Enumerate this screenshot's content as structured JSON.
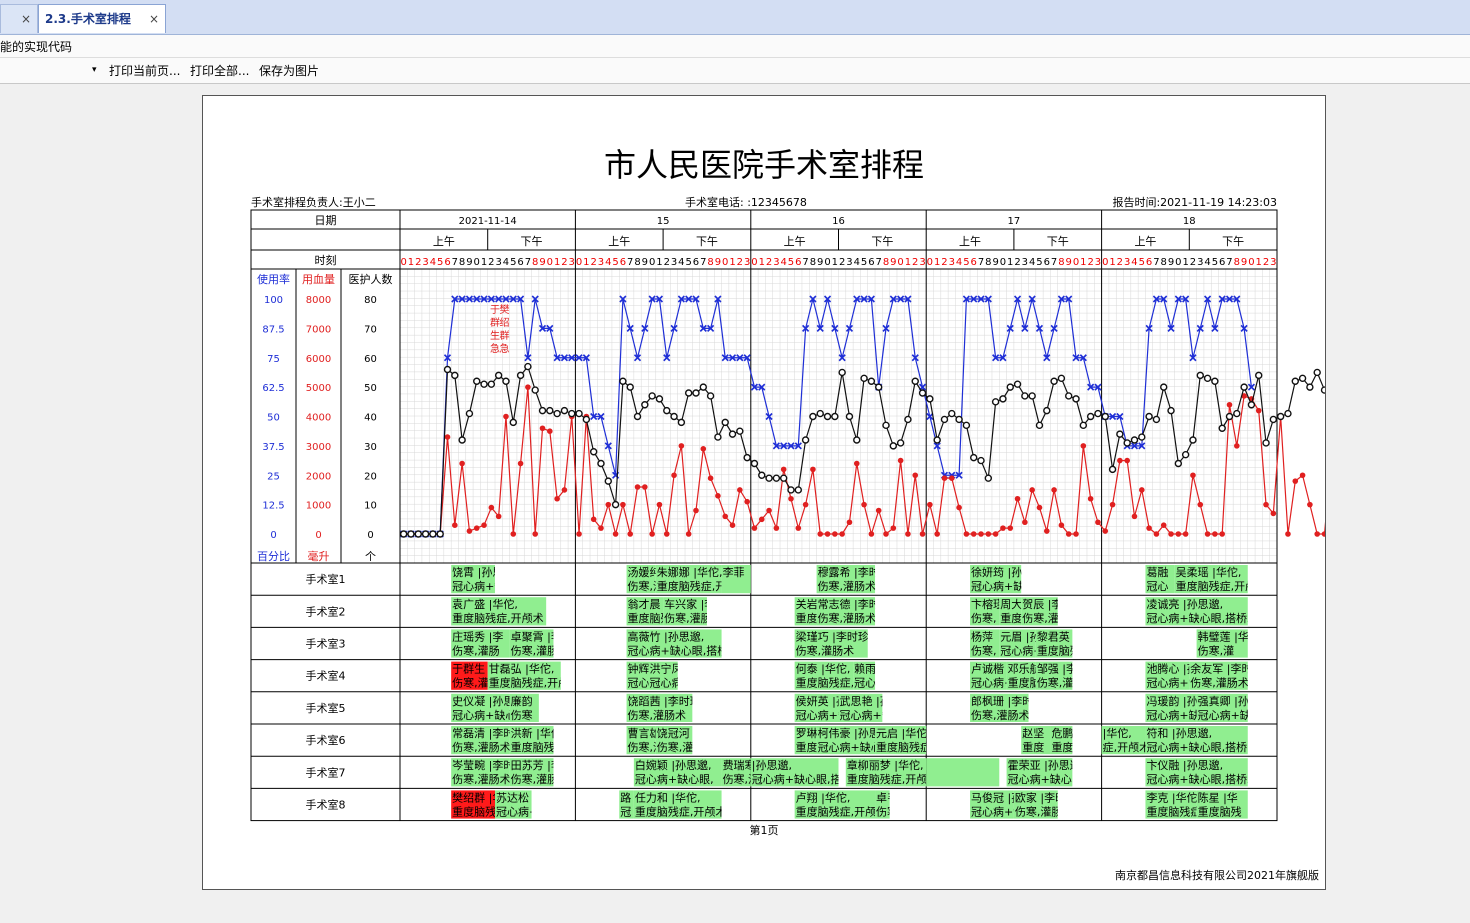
{
  "tabs": [
    {
      "label": "",
      "close": "×"
    },
    {
      "label": "2.3.手术室排程",
      "close": "×"
    }
  ],
  "subbar": {
    "text": "能的实现代码"
  },
  "toolbar": {
    "dropdown_glyph": "▾",
    "print_current": "打印当前页...",
    "print_all": "打印全部...",
    "save_image": "保存为图片"
  },
  "report": {
    "title": "市人民医院手术室排程",
    "manager": "手术室排程负责人:王小二",
    "phone": "手术室电话: :12345678",
    "report_time": "报告时间:2021-11-19 14:23:03",
    "page_label": "第1页",
    "footer": "南京都昌信息科技有限公司2021年旗舰版"
  },
  "grid": {
    "date_label": "日期",
    "time_label": "时刻",
    "dates": [
      "2021-11-14",
      "15",
      "16",
      "17",
      "18"
    ],
    "am": "上午",
    "pm": "下午",
    "axis_headers": [
      "使用率",
      "用血量",
      "医护人数"
    ],
    "axis_units": [
      "百分比",
      "毫升",
      "个"
    ],
    "usage_ticks": [
      "100",
      "87.5",
      "75",
      "62.5",
      "50",
      "37.5",
      "25",
      "12.5",
      "0"
    ],
    "blood_ticks": [
      "8000",
      "7000",
      "6000",
      "5000",
      "4000",
      "3000",
      "2000",
      "1000",
      "0"
    ],
    "staff_ticks": [
      "80",
      "70",
      "60",
      "50",
      "40",
      "30",
      "20",
      "10",
      "0"
    ],
    "room_labels": [
      "手术室1",
      "手术室2",
      "手术室3",
      "手术室4",
      "手术室5",
      "手术室6",
      "手术室7",
      "手术室8"
    ]
  },
  "chart_data": {
    "type": "line",
    "x_unit": "hour",
    "series": [
      {
        "name": "使用率",
        "color": "#1f2fd6",
        "marker": "x",
        "axis": "百分比",
        "values": [
          0,
          0,
          0,
          0,
          0,
          0,
          75,
          100,
          100,
          100,
          100,
          100,
          100,
          100,
          100,
          100,
          100,
          75,
          100,
          87.5,
          87.5,
          75,
          75,
          75,
          75,
          75,
          50,
          50,
          37.5,
          25,
          100,
          87.5,
          75,
          87.5,
          100,
          100,
          75,
          87.5,
          100,
          100,
          100,
          87.5,
          87.5,
          100,
          75,
          75,
          75,
          75,
          62.5,
          62.5,
          50,
          37.5,
          37.5,
          37.5,
          37.5,
          87.5,
          100,
          87.5,
          100,
          87.5,
          75,
          87.5,
          100,
          100,
          100,
          62.5,
          87.5,
          100,
          100,
          100,
          75,
          62.5,
          50,
          37.5,
          25,
          25,
          25,
          100,
          100,
          100,
          100,
          75,
          75,
          87.5,
          100,
          87.5,
          100,
          87.5,
          75,
          87.5,
          100,
          100,
          75,
          75,
          62.5,
          62.5,
          50,
          50,
          50,
          37.5,
          37.5,
          37.5,
          87.5,
          100,
          100,
          87.5,
          100,
          100,
          75,
          87.5,
          100,
          87.5,
          100,
          100,
          100,
          87.5,
          62.5
        ]
      },
      {
        "name": "用血量",
        "color": "#e02020",
        "marker": "dot",
        "axis": "毫升",
        "values": [
          0,
          0,
          0,
          0,
          0,
          0,
          3300,
          300,
          2400,
          100,
          200,
          300,
          900,
          600,
          4000,
          0,
          2400,
          5000,
          0,
          3600,
          3500,
          1200,
          1500,
          4000,
          0,
          4000,
          500,
          200,
          1000,
          0,
          1000,
          0,
          1600,
          1600,
          0,
          1000,
          0,
          2000,
          3000,
          0,
          800,
          2900,
          1900,
          1300,
          600,
          300,
          1500,
          1100,
          200,
          500,
          800,
          200,
          2200,
          1200,
          200,
          1000,
          2200,
          0,
          0,
          0,
          0,
          400,
          2400,
          1000,
          0,
          800,
          0,
          200,
          2500,
          0,
          2000,
          0,
          1000,
          0,
          1900,
          1900,
          900,
          0,
          0,
          0,
          0,
          0,
          200,
          200,
          1200,
          400,
          1500,
          900,
          100,
          1500,
          300,
          0,
          0,
          3000,
          1200,
          400,
          100,
          1000,
          2500,
          2500,
          600,
          1500,
          200,
          0,
          300,
          0,
          0,
          0,
          2000,
          1000,
          0,
          0,
          0,
          4400,
          3000,
          4700,
          4600,
          4200,
          1000,
          700,
          4000,
          0,
          1800,
          2000,
          1000,
          0,
          0,
          2800,
          3000,
          1500,
          1500,
          3200,
          2700,
          0,
          1000
        ]
      },
      {
        "name": "医护人数",
        "color": "#111111",
        "marker": "circle",
        "axis": "个",
        "values": [
          0,
          0,
          0,
          0,
          0,
          0,
          56,
          54,
          32,
          41,
          52,
          51,
          51,
          54,
          52,
          38,
          54,
          57,
          49,
          42,
          42,
          41,
          42,
          41,
          41,
          39,
          28,
          24,
          18,
          10,
          52,
          50,
          40,
          44,
          47,
          46,
          42,
          40,
          38,
          48,
          48,
          50,
          47,
          33,
          38,
          34,
          35,
          26,
          24,
          20,
          19,
          19,
          19,
          15,
          15,
          32,
          40,
          41,
          40,
          40,
          55,
          40,
          32,
          53,
          52,
          50,
          37,
          30,
          31,
          39,
          52,
          48,
          46,
          32,
          39,
          41,
          39,
          37,
          26,
          25,
          19,
          45,
          46,
          50,
          51,
          47,
          47,
          37,
          42,
          52,
          53,
          47,
          46,
          37,
          40,
          41,
          40,
          22,
          34,
          31,
          32,
          33,
          40,
          39,
          50,
          42,
          24,
          27,
          32,
          54,
          53,
          52,
          36,
          40,
          41,
          50,
          44,
          54,
          31,
          39,
          40,
          41,
          52,
          53,
          50,
          55,
          49,
          51,
          38,
          29
        ]
      }
    ]
  },
  "rooms": [
    [
      {
        "d": 0,
        "s": 7,
        "e": 13,
        "color": "#90ee90",
        "l1": "饶霄 |孙思邈,",
        "l2": "冠心病+缺心眼,搭"
      },
      {
        "d": 1,
        "s": 7,
        "e": 11,
        "color": "#90ee90",
        "l1": "汤媛纯 |李时珍",
        "l2": "伤寒,灌肠术"
      },
      {
        "d": 1,
        "s": 11,
        "e": 20,
        "color": "#90ee90",
        "l1": "朱娜娜 |华佗,",
        "l2": "重度脑残症,开颅术"
      },
      {
        "d": 1,
        "s": 20,
        "e": 24,
        "color": "#90ee90",
        "l1": "李菲",
        "l2": ""
      },
      {
        "d": 2,
        "s": 9,
        "e": 17,
        "color": "#90ee90",
        "l1": "穆露希 |李时珍",
        "l2": "伤寒,灌肠术"
      },
      {
        "d": 3,
        "s": 6,
        "e": 13,
        "color": "#90ee90",
        "l1": "徐妍筠 |孙思邈,",
        "l2": "冠心病+缺心眼,搭"
      },
      {
        "d": 4,
        "s": 6,
        "e": 10,
        "color": "#90ee90",
        "l1": "葛融",
        "l2": "冠心"
      },
      {
        "d": 4,
        "s": 10,
        "e": 20,
        "color": "#90ee90",
        "l1": "吴柔瑶 |华佗,",
        "l2": "重度脑残症,开颅"
      }
    ],
    [
      {
        "d": 0,
        "s": 7,
        "e": 20,
        "color": "#90ee90",
        "l1": "袁广盛 |华佗,",
        "l2": "重度脑残症,开颅术"
      },
      {
        "d": 1,
        "s": 7,
        "e": 12,
        "color": "#90ee90",
        "l1": "翁才晨",
        "l2": "重度脑残"
      },
      {
        "d": 1,
        "s": 12,
        "e": 18,
        "color": "#90ee90",
        "l1": "车兴家 |李",
        "l2": "伤寒,灌肠"
      },
      {
        "d": 2,
        "s": 6,
        "e": 9,
        "color": "#90ee90",
        "l1": "关岩",
        "l2": "重度"
      },
      {
        "d": 2,
        "s": 9,
        "e": 17,
        "color": "#90ee90",
        "l1": "常志德 |李时珍",
        "l2": "伤寒,灌肠术"
      },
      {
        "d": 3,
        "s": 6,
        "e": 10,
        "color": "#90ee90",
        "l1": "卞榕瑾",
        "l2": "伤寒,"
      },
      {
        "d": 3,
        "s": 10,
        "e": 13,
        "color": "#90ee90",
        "l1": "周大",
        "l2": "重度"
      },
      {
        "d": 3,
        "s": 13,
        "e": 18,
        "color": "#90ee90",
        "l1": "贺辰 |李时",
        "l2": "伤寒,灌肠"
      },
      {
        "d": 4,
        "s": 6,
        "e": 20,
        "color": "#90ee90",
        "l1": "凌诚亮 |孙思邈,",
        "l2": "冠心病+缺心眼,搭桥术"
      }
    ],
    [
      {
        "d": 0,
        "s": 7,
        "e": 15,
        "color": "#90ee90",
        "l1": "庄瑶秀 |李",
        "l2": "伤寒,灌肠"
      },
      {
        "d": 0,
        "s": 15,
        "e": 21,
        "color": "#90ee90",
        "l1": "卓聚霄 |李时珍",
        "l2": "伤寒,灌肠术"
      },
      {
        "d": 1,
        "s": 7,
        "e": 20,
        "color": "#90ee90",
        "l1": "高薇竹 |孙思邈,",
        "l2": "冠心病+缺心眼,搭桥术"
      },
      {
        "d": 2,
        "s": 6,
        "e": 16,
        "color": "#90ee90",
        "l1": "梁瑾巧 |李时珍",
        "l2": "伤寒,灌肠术"
      },
      {
        "d": 3,
        "s": 6,
        "e": 10,
        "color": "#90ee90",
        "l1": "杨萍",
        "l2": "伤寒,"
      },
      {
        "d": 3,
        "s": 10,
        "e": 15,
        "color": "#90ee90",
        "l1": "元眉 |孙思邈",
        "l2": "冠心病+缺"
      },
      {
        "d": 3,
        "s": 15,
        "e": 20,
        "color": "#90ee90",
        "l1": "黎君英 |华佗,",
        "l2": "重度脑残症,开颅术"
      },
      {
        "d": 4,
        "s": 13,
        "e": 20,
        "color": "#90ee90",
        "l1": "韩璧莲 |华",
        "l2": "伤寒,灌"
      }
    ],
    [
      {
        "d": 0,
        "s": 7,
        "e": 12,
        "color": "#ff1a1a",
        "l1": "于群生 |李时",
        "l2": "伤寒,灌肠"
      },
      {
        "d": 0,
        "s": 12,
        "e": 22,
        "color": "#90ee90",
        "l1": "甘磊弘 |华佗,",
        "l2": "重度脑残症,开颅术"
      },
      {
        "d": 1,
        "s": 7,
        "e": 10,
        "color": "#90ee90",
        "l1": "钟辉",
        "l2": "冠心病+缺"
      },
      {
        "d": 1,
        "s": 10,
        "e": 14,
        "color": "#90ee90",
        "l1": "洪宁凤",
        "l2": "冠心病"
      },
      {
        "d": 2,
        "s": 6,
        "e": 14,
        "color": "#90ee90",
        "l1": "何泰 |华佗,",
        "l2": "重度脑残症,开颅"
      },
      {
        "d": 2,
        "s": 14,
        "e": 17,
        "color": "#90ee90",
        "l1": "赖雨",
        "l2": "冠心"
      },
      {
        "d": 3,
        "s": 6,
        "e": 11,
        "color": "#90ee90",
        "l1": "卢诚楷",
        "l2": "冠心病+"
      },
      {
        "d": 3,
        "s": 11,
        "e": 15,
        "color": "#90ee90",
        "l1": "邓乐航",
        "l2": "重度脑"
      },
      {
        "d": 3,
        "s": 15,
        "e": 20,
        "color": "#90ee90",
        "l1": "邹强 |李时珍",
        "l2": "伤寒,灌肠术"
      },
      {
        "d": 4,
        "s": 6,
        "e": 12,
        "color": "#90ee90",
        "l1": "池腾心 |孙",
        "l2": "冠心病+缺"
      },
      {
        "d": 4,
        "s": 12,
        "e": 20,
        "color": "#90ee90",
        "l1": "余友军 |李时",
        "l2": "伤寒,灌肠术"
      }
    ],
    [
      {
        "d": 0,
        "s": 7,
        "e": 15,
        "color": "#90ee90",
        "l1": "史仪凝 |孙思邈,",
        "l2": "冠心病+缺心眼,"
      },
      {
        "d": 0,
        "s": 15,
        "e": 19,
        "color": "#90ee90",
        "l1": "廉韵",
        "l2": "伤寒"
      },
      {
        "d": 1,
        "s": 7,
        "e": 16,
        "color": "#90ee90",
        "l1": "饶蹈茜 |李时珍",
        "l2": "伤寒,灌肠术"
      },
      {
        "d": 2,
        "s": 6,
        "e": 12,
        "color": "#90ee90",
        "l1": "侯妍英 |孙",
        "l2": "冠心病+缺"
      },
      {
        "d": 2,
        "s": 12,
        "e": 18,
        "color": "#90ee90",
        "l1": "武思艳 |孙思邈",
        "l2": "冠心病+缺心眼"
      },
      {
        "d": 3,
        "s": 6,
        "e": 14,
        "color": "#90ee90",
        "l1": "郎枫珊 |李时珍",
        "l2": "伤寒,灌肠术"
      },
      {
        "d": 4,
        "s": 6,
        "e": 13,
        "color": "#90ee90",
        "l1": "冯瑗韵 |孙",
        "l2": "冠心病+缺"
      },
      {
        "d": 4,
        "s": 13,
        "e": 20,
        "color": "#90ee90",
        "l1": "强真卿 |孙思",
        "l2": "冠心病+缺心"
      }
    ],
    [
      {
        "d": 0,
        "s": 7,
        "e": 15,
        "color": "#90ee90",
        "l1": "常磊清 |李时珍",
        "l2": "伤寒,灌肠术"
      },
      {
        "d": 0,
        "s": 15,
        "e": 21,
        "color": "#90ee90",
        "l1": "洪新 |华佗,",
        "l2": "重度脑残症,开"
      },
      {
        "d": 1,
        "s": 7,
        "e": 11,
        "color": "#90ee90",
        "l1": "曹言雄",
        "l2": "伤寒,灌"
      },
      {
        "d": 1,
        "s": 11,
        "e": 16,
        "color": "#90ee90",
        "l1": "饶冠河 |李",
        "l2": "伤寒,灌肠"
      },
      {
        "d": 2,
        "s": 6,
        "e": 9,
        "color": "#90ee90",
        "l1": "罗琳",
        "l2": "重度"
      },
      {
        "d": 2,
        "s": 9,
        "e": 17,
        "color": "#90ee90",
        "l1": "柯伟豪 |孙思邈",
        "l2": "冠心病+缺心眼"
      },
      {
        "d": 2,
        "s": 17,
        "e": 24,
        "color": "#90ee90",
        "l1": "元启 |华佗,",
        "l2": "重度脑残症,开颅术"
      },
      {
        "d": 3,
        "s": 13,
        "e": 17,
        "color": "#90ee90",
        "l1": "赵坚",
        "l2": "重度"
      },
      {
        "d": 3,
        "s": 17,
        "e": 20,
        "color": "#90ee90",
        "l1": "危鹏伯",
        "l2": "重度脑残"
      },
      {
        "d": 4,
        "s": 0,
        "e": 6,
        "color": "#90ee90",
        "l1": "|华佗,",
        "l2": "症,开颅术"
      },
      {
        "d": 4,
        "s": 6,
        "e": 20,
        "color": "#90ee90",
        "l1": "符和 |孙思邈,",
        "l2": "冠心病+缺心眼,搭桥"
      }
    ],
    [
      {
        "d": 0,
        "s": 7,
        "e": 15,
        "color": "#90ee90",
        "l1": "岑莹畹 |李时珍",
        "l2": "伤寒,灌肠术"
      },
      {
        "d": 0,
        "s": 15,
        "e": 21,
        "color": "#90ee90",
        "l1": "田苏芳 |李时珍",
        "l2": "伤寒,灌肠术"
      },
      {
        "d": 1,
        "s": 8,
        "e": 20,
        "color": "#90ee90",
        "l1": "白婉颖 |孙思邈,",
        "l2": "冠心病+缺心眼,"
      },
      {
        "d": 1,
        "s": 20,
        "e": 24,
        "color": "#90ee90",
        "l1": "费瑞寒 |李",
        "l2": "伤寒,灌肠"
      },
      {
        "d": 2,
        "s": 0,
        "e": 12,
        "color": "#90ee90",
        "l1": "|孙思邈,",
        "l2": "冠心病+缺心眼,搭桥术"
      },
      {
        "d": 2,
        "s": 13,
        "e": 24,
        "color": "#90ee90",
        "l1": "章柳丽梦 |华佗,",
        "l2": "重度脑残症,开颅术"
      },
      {
        "d": 3,
        "s": 0,
        "e": 10,
        "color": "#90ee90",
        "l1": "",
        "l2": ""
      },
      {
        "d": 3,
        "s": 11,
        "e": 20,
        "color": "#90ee90",
        "l1": "霍荣亚 |孙思邈",
        "l2": "冠心病+缺心眼"
      },
      {
        "d": 4,
        "s": 6,
        "e": 20,
        "color": "#90ee90",
        "l1": "卞仪融 |孙思邈,",
        "l2": "冠心病+缺心眼,搭桥术"
      }
    ],
    [
      {
        "d": 0,
        "s": 7,
        "e": 13,
        "color": "#ff1a1a",
        "l1": "樊绍群 |华佗,",
        "l2": "重度脑残症,开"
      },
      {
        "d": 0,
        "s": 13,
        "e": 18,
        "color": "#90ee90",
        "l1": "苏达松 |孙",
        "l2": "冠心病+缺"
      },
      {
        "d": 1,
        "s": 6,
        "e": 8,
        "color": "#90ee90",
        "l1": "路",
        "l2": "冠"
      },
      {
        "d": 1,
        "s": 8,
        "e": 20,
        "color": "#90ee90",
        "l1": "任力和 |华佗,",
        "l2": "重度脑残症,开颅术"
      },
      {
        "d": 2,
        "s": 6,
        "e": 17,
        "color": "#90ee90",
        "l1": "卢翔 |华佗,",
        "l2": "重度脑残症,开颅"
      },
      {
        "d": 2,
        "s": 17,
        "e": 19,
        "color": "#90ee90",
        "l1": "卓韦",
        "l2": "伤寒"
      },
      {
        "d": 3,
        "s": 6,
        "e": 12,
        "color": "#90ee90",
        "l1": "马俊冠 |孙思邈",
        "l2": "冠心病+缺心眼"
      },
      {
        "d": 3,
        "s": 12,
        "e": 18,
        "color": "#90ee90",
        "l1": "欧家 |李时珍",
        "l2": "伤寒,灌肠术"
      },
      {
        "d": 4,
        "s": 6,
        "e": 13,
        "color": "#90ee90",
        "l1": "李克 |华佗,",
        "l2": "重度脑残症,开颅"
      },
      {
        "d": 4,
        "s": 13,
        "e": 20,
        "color": "#90ee90",
        "l1": "陈星 |华",
        "l2": "重度脑残"
      }
    ]
  ],
  "annotations": [
    {
      "label": "手术室4患者于群生预警",
      "text": "于群生 急",
      "color": "#e02020"
    },
    {
      "label": "手术室8患者樊绍群预警",
      "text": "樊绍群 急",
      "color": "#e02020"
    }
  ]
}
